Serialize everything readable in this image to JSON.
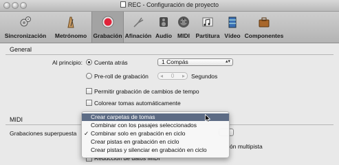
{
  "window": {
    "title": "REC - Configuración de proyecto"
  },
  "toolbar": {
    "items": [
      {
        "label": "Sincronización",
        "icon": "gears-icon"
      },
      {
        "label": "Metrónomo",
        "icon": "metronome-icon"
      },
      {
        "label": "Grabación",
        "icon": "record-icon",
        "selected": true
      },
      {
        "label": "Afinación",
        "icon": "tuning-fork-icon"
      },
      {
        "label": "Audio",
        "icon": "audio-icon"
      },
      {
        "label": "MIDI",
        "icon": "midi-icon"
      },
      {
        "label": "Partitura",
        "icon": "score-icon"
      },
      {
        "label": "Vídeo",
        "icon": "video-icon"
      },
      {
        "label": "Componentes",
        "icon": "briefcase-icon"
      }
    ]
  },
  "general": {
    "title": "General",
    "al_principio_label": "Al principio:",
    "cuenta_atras_label": "Cuenta atrás",
    "cuenta_atras_value": "1 Compás",
    "preroll_label": "Pre-roll de grabación",
    "preroll_value": "0",
    "segundos_label": "Segundos",
    "permitir_label": "Permitir grabación de cambios de tempo",
    "colorear_label": "Colorear tomas automáticamente"
  },
  "midi": {
    "title": "MIDI",
    "grabaciones_label": "Grabaciones superpuesta",
    "multipista_partial": "ón multipista",
    "reduccion_partial": "Reducción de datos MIDI"
  },
  "popup": {
    "items": [
      {
        "label": "Crear carpetas de tomas",
        "highlighted": true,
        "checked": false
      },
      {
        "label": "Combinar con los pasajes seleccionados",
        "highlighted": false,
        "checked": false
      },
      {
        "label": "Combinar solo en grabación en ciclo",
        "highlighted": false,
        "checked": true
      },
      {
        "label": "Crear pistas en grabación en ciclo",
        "highlighted": false,
        "checked": false
      },
      {
        "label": "Crear pistas y silenciar en grabación en ciclo",
        "highlighted": false,
        "checked": false
      }
    ],
    "check_glyph": "✓"
  }
}
